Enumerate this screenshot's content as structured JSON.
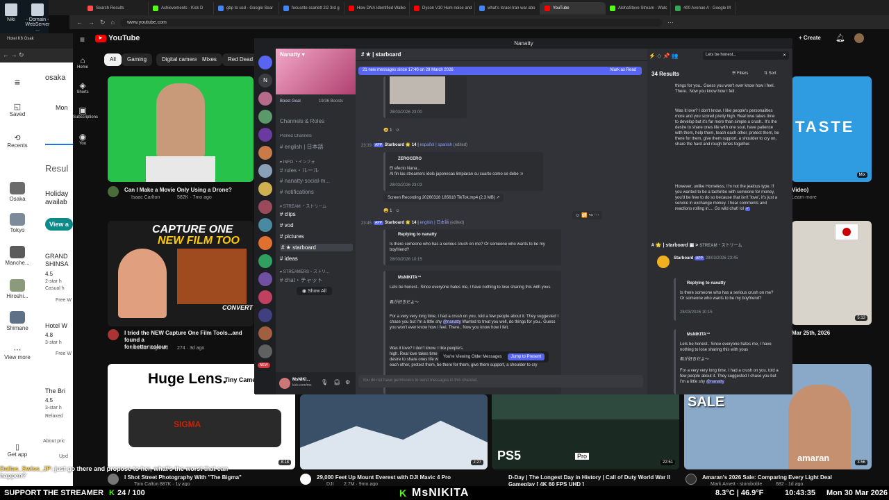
{
  "desktop": {
    "icons": [
      {
        "label": "Niki"
      },
      {
        "label": "- Domain - WebServer ..."
      }
    ]
  },
  "browser": {
    "tabs": [
      {
        "label": "Search Results",
        "color": "#ff4d4d"
      },
      {
        "label": "Achievements - Kick D",
        "color": "#53fc18"
      },
      {
        "label": "gbp to usd - Google Sear",
        "color": "#4285f4"
      },
      {
        "label": "focusrite scarlett 2i2 3rd g",
        "color": "#4285f4"
      },
      {
        "label": "How DNA Identified Walke",
        "color": "#ff0000"
      },
      {
        "label": "Dyson V10 Hum noise and",
        "color": "#ff0000"
      },
      {
        "label": "what's Israel-Iran war abo",
        "color": "#4285f4"
      },
      {
        "label": "YouTube",
        "color": "#ff0000",
        "active": true
      },
      {
        "label": "AlohaSteve Stream - Watc",
        "color": "#53fc18"
      },
      {
        "label": "400 Avenue A - Google M",
        "color": "#34a853"
      }
    ],
    "url": "www.youtube.com"
  },
  "browser2": {
    "tab": "Hotel K6 Osak",
    "search": "osaka",
    "date": "Mon",
    "results": "Resul",
    "holiday": "Holiday availab",
    "view": "View a",
    "hotels": [
      {
        "name": "GRAND SHINSA",
        "rating": "4.5",
        "stars": "2-star h",
        "type": "Casual h",
        "wifi": "Free W"
      },
      {
        "name": "Hotel W",
        "rating": "4.8",
        "stars": "3-star h",
        "wifi": "Free W"
      },
      {
        "name": "The Bri",
        "rating": "4.5",
        "stars": "3-star h",
        "type": "Relaxed"
      }
    ],
    "about": "About pric",
    "upd": "Upd",
    "nav": [
      {
        "label": "Saved"
      },
      {
        "label": "Recents"
      },
      {
        "label": "Osaka"
      },
      {
        "label": "Tokyo"
      },
      {
        "label": "Manche..."
      },
      {
        "label": "Hiroshi..."
      },
      {
        "label": "Shimane"
      },
      {
        "label": "View more"
      },
      {
        "label": "Get app"
      }
    ]
  },
  "youtube": {
    "logo": "YouTube",
    "create": "Create",
    "nav": [
      {
        "label": "Home"
      },
      {
        "label": "Shorts"
      },
      {
        "label": "Subscriptions"
      },
      {
        "label": "You"
      }
    ],
    "chips": [
      "All",
      "Gaming",
      "Digital cameras",
      "Mixes",
      "Red Dead R"
    ],
    "videos": [
      {
        "title": "Can I Make a Movie Only Using a Drone?",
        "channel": "Isaac Carlton",
        "meta": "582K · 7mo ago"
      },
      {
        "title": "I tried the NEW Capture One Film Tools...and found a",
        "title2": "for better colour",
        "channel": "thomas fitzgerald",
        "meta": "274 · 3d ago",
        "thumb_text": "CAPTURE ONE",
        "thumb_text2": "NEW FILM TOO",
        "thumb_text3": "CONVERT"
      },
      {
        "title": "I Shot Street Photography With \"The Bigma\"",
        "channel": "Tom Calton",
        "meta": "887K · 1y ago",
        "duration": "8:18",
        "thumb_text": "Huge Lens.",
        "thumb_text2": "Tiny Camera"
      },
      {
        "title": "29,000 Feet Up Mount Everest with DJI Mavic 4 Pro",
        "channel": "DJI",
        "meta": "2.7M · 9mo ago",
        "duration": "2:27"
      },
      {
        "title": "D-Day | The Longest Day in History | Call of Duty World War II",
        "title2": "Gameplay [ 4K 60 FPS UHD ]",
        "channel": "",
        "meta": "",
        "duration": "22:51",
        "thumb_text": "PS5",
        "thumb_text2": "Pro"
      },
      {
        "title": "Amaran's 2026 Sale: Comparing Every Light Deal",
        "channel": "Mark Arnett - storyboble",
        "meta": "682 · 1d ago",
        "duration": "3:56",
        "thumb_text": "SALE",
        "thumb_text2": "amaran"
      },
      {
        "title": "Video)",
        "meta": "Learn more",
        "thumb_text": "TASTE",
        "duration": "Mix"
      },
      {
        "title": "Mar 25th, 2026",
        "duration": "5:13"
      }
    ]
  },
  "discord": {
    "window_title": "Nanatty",
    "server": "Nanatty",
    "boost_goal": "Boost Goal",
    "boost_count": "19/36 Boosts",
    "channels_roles": "Channels & Roles",
    "pinned": "Pinned Channels",
    "channels": [
      {
        "name": "english | 日本語"
      },
      {
        "name": "INFO ・インフォ"
      },
      {
        "name": "rules・ルール"
      },
      {
        "name": "nanatty-social-m..."
      },
      {
        "name": "notifications"
      },
      {
        "name": "STREAM ・ストリーム"
      },
      {
        "name": "clips"
      },
      {
        "name": "vod"
      },
      {
        "name": "pictures"
      },
      {
        "name": "starboard",
        "active": true
      },
      {
        "name": "ideas"
      },
      {
        "name": "STREAMERS・ストリ..."
      },
      {
        "name": "chat・チャット"
      }
    ],
    "show_all": "Show All",
    "user": {
      "name": "MsNIKI...",
      "status": "kick.com/ms"
    },
    "channel_name": "starboard",
    "new_banner": "21 new messages since 17:40 on 29 March 2026",
    "mark_read": "Mark as Read",
    "messages": [
      {
        "time": "28/03/2026 23:00"
      },
      {
        "ts": "23:19",
        "author": "Starboard",
        "app": "APP",
        "count": "14",
        "chan": "español | spanish",
        "edited": "(edited)",
        "quote_author": "ZEROCERO",
        "line1": "El efecto Nana...",
        "line2": "Al fin las streamers idols japonesas limpiaran su cuarto como se debe :v",
        "date": "28/03/2026 23:03",
        "attachment": "Screen Recording 20260328 185618 TikTok.mp4 (2.3 MB)"
      },
      {
        "ts": "23:45",
        "author": "Starboard",
        "app": "APP",
        "count": "14",
        "chan": "english | 日本語",
        "edited": "(edited)",
        "reply": "Replying to nanatty",
        "reply_text": "Is there someone who has a serious crush on me? Or someone who wants to be my boyfriend?",
        "reply_date": "28/03/2026 10:15",
        "author2": "MsNIKITA™",
        "text1": "Lets be honest.. Since everyone hates me, I have nothing to lose sharing this with yous",
        "text2": "君が好きだよ〜",
        "text3": "For a very very long time, I had a crush on you, told a few people about it. They suggested I chase you but I'm a little shy",
        "mention": "@nanatty",
        "text4": "Wanted to treat you well, do things for you.. Guess you won't ever know how I feel. There.. Now you know how I felt.",
        "text5": "Was it love? I don't know. I like people's",
        "text6": "high. Real love takes time",
        "text7": "desire to share ones life w",
        "text8": "each other, protect them, be there for them, give them support, a shoulder to cry"
      }
    ],
    "older_msgs": "You're Viewing Older Messages",
    "jump": "Jump to Present",
    "no_perm": "You do not have permission to send messages in this channel.",
    "search_query": "Lets be honest...",
    "results": "34 Results",
    "filters": "Filters",
    "sort": "Sort",
    "result_text1": "things for you.. Guess you won't ever know how I feel. There.. Now you know how I felt.",
    "result_text2": "Was it love? I don't know. I like people's personalities more and you scored pretty high. Real love takes time to develop but it's far more than simple a crush.. It's the desire to share ones life with one soul, have patience with them, help them, teach each other, protect them, be there for them, give them support, a shoulder to cry on, share the hard and rough times together.",
    "result_text3": "However, unlike Homeless, I'm not the jealous type. If you wanted to be a tachinbo with someone for money, you'd be free to do so because that isn't 'love', it's just a service in exchange money. I hear comments and reactions rolling in.... Go wild chat! lol",
    "result_channel": "starboard",
    "result_stream": "STREAM・ストリーム",
    "result_author": "Starboard",
    "result_time": "28/03/2026 23:45",
    "result_reply": "Replying to nanatty",
    "result_reply_text": "Is there someone who has a serious crush on me? Or someone who wants to be my boyfriend?",
    "result_reply_date": "28/03/2026 10:15",
    "result_author2": "MsNIKITA™",
    "result_text4": "Lets be honest.. Since everyone hates me, I have nothing to lose sharing this with yous",
    "result_text5": "君が好きだよ〜",
    "result_text6": "For a very very long time, I had a crush on you, told a few people about it. They suggested I chase you but I'm a little shy",
    "result_mention": "@nanatty"
  },
  "stream": {
    "chat_user": "Dallas_Swiss_JP",
    "chat_msg": ": just go there and propose to her, what's the worst that can happen?",
    "support": "SUPPORT THE STREAMER",
    "progress": "24 / 100",
    "name": "MsNIKITA",
    "weather": "8.3°C | 46.9°F",
    "clock": "10:43:35",
    "date": "Mon 30 Mar 2026"
  },
  "colors": {
    "discord_blurple": "#5865f2",
    "kick_green": "#53fc18",
    "yt_red": "#ff0000"
  }
}
